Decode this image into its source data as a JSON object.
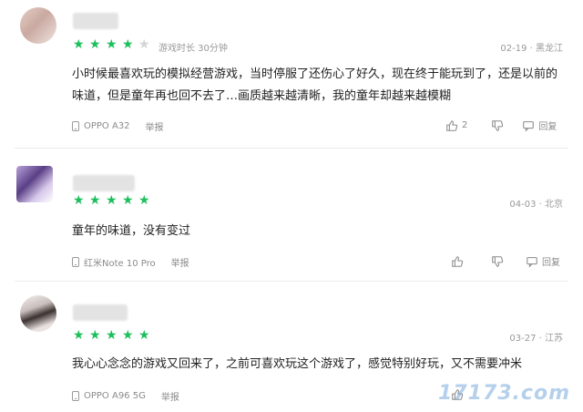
{
  "reviews": [
    {
      "stars": [
        true,
        true,
        true,
        true,
        false
      ],
      "playtime": "游戏时长 30分钟",
      "meta": "02-19 · 黑龙江",
      "text": "小时候最喜欢玩的模拟经营游戏，当时停服了还伤心了好久，现在终于能玩到了，还是以前的味道，但是童年再也回不去了…画质越来越清晰，我的童年却越来越模糊",
      "device": "OPPO A32",
      "report": "举报",
      "likes": "2",
      "reply": "回复"
    },
    {
      "stars": [
        true,
        true,
        true,
        true,
        true
      ],
      "playtime": "",
      "meta": "04-03 · 北京",
      "text": "童年的味道，没有变过",
      "device": "红米Note 10 Pro",
      "report": "举报",
      "likes": "",
      "reply": "回复"
    },
    {
      "stars": [
        true,
        true,
        true,
        true,
        true
      ],
      "playtime": "",
      "meta": "03-27 · 江苏",
      "text": "我心心念念的游戏又回来了，之前可喜欢玩这个游戏了，感觉特别好玩，又不需要冲米",
      "device": "OPPO A96 5G",
      "report": "举报",
      "likes": "",
      "reply": "回复"
    }
  ],
  "colors": {
    "star_on": "#1cbf5c",
    "star_off": "#d4d4d4",
    "meta": "#999999"
  },
  "icons": [
    "phone-icon",
    "thumbs-up-icon",
    "thumbs-down-icon",
    "reply-icon",
    "star-icon"
  ],
  "watermark": "17173.com"
}
